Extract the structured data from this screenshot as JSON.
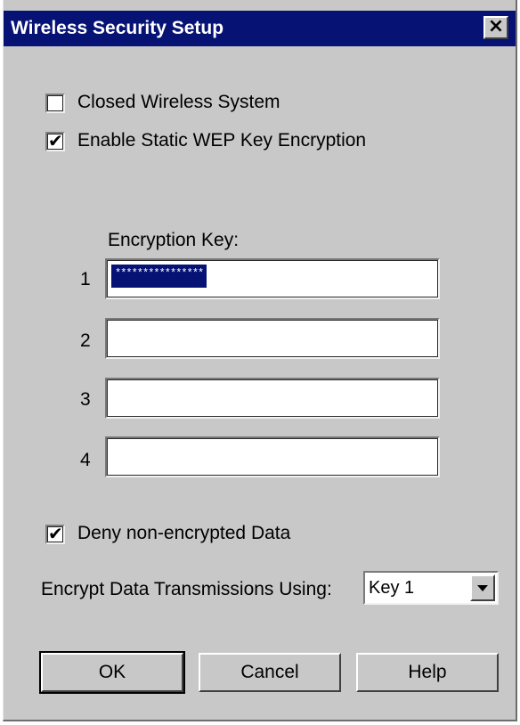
{
  "window": {
    "title": "Wireless Security Setup",
    "close_label": "×"
  },
  "options": {
    "closed_wireless": {
      "label": "Closed Wireless System",
      "checked": false
    },
    "static_wep": {
      "label": "Enable Static WEP Key Encryption",
      "checked": true
    },
    "deny_unencrypted": {
      "label": "Deny non-encrypted Data",
      "checked": true
    }
  },
  "encryption_keys": {
    "heading": "Encryption Key:",
    "keys": [
      {
        "number": "1",
        "value": "****************"
      },
      {
        "number": "2",
        "value": ""
      },
      {
        "number": "3",
        "value": ""
      },
      {
        "number": "4",
        "value": ""
      }
    ]
  },
  "transmit": {
    "label": "Encrypt Data Transmissions Using:",
    "selected": "Key 1"
  },
  "buttons": {
    "ok": "OK",
    "cancel": "Cancel",
    "help": "Help"
  },
  "colors": {
    "titlebar": "#061274",
    "dialog_bg": "#c8c8c8",
    "selection": "#061274"
  }
}
